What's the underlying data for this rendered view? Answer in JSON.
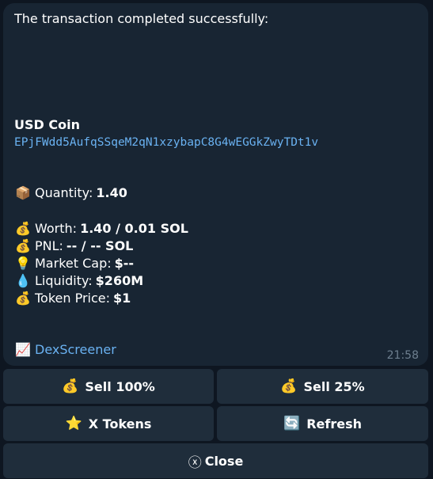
{
  "message": {
    "intro": "The transaction completed successfully:",
    "coin_name": "USD Coin",
    "address": "EPjFWdd5AufqSSqeM2qN1xzybapC8G4wEGGkZwyTDt1v",
    "quantity_label": "Quantity:",
    "quantity_value": "1.40",
    "worth_label": "Worth:",
    "worth_value": "1.40 / 0.01 SOL",
    "pnl_label": "PNL:",
    "pnl_value": "-- / -- SOL",
    "mcap_label": "Market Cap:",
    "mcap_value": "$--",
    "liquidity_label": "Liquidity:",
    "liquidity_value": "$260M",
    "price_label": "Token Price:",
    "price_value": "$1",
    "dex_link": "DexScreener",
    "time": "21:58"
  },
  "icons": {
    "package": "📦",
    "money_bag": "💰",
    "bulb": "💡",
    "droplet": "💧",
    "chart": "📈",
    "star": "⭐",
    "refresh": "🔄",
    "close": "ⓧ"
  },
  "buttons": {
    "sell_100": "Sell 100%",
    "sell_25": "Sell 25%",
    "x_tokens": "X Tokens",
    "refresh": "Refresh",
    "close": "Close"
  },
  "colors": {
    "background": "#0e1621",
    "bubble": "#182533",
    "button": "#1f2d3b",
    "link": "#6ab2f2"
  }
}
